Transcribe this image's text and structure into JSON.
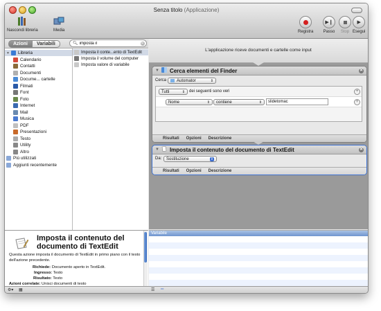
{
  "window": {
    "title": "Senza titolo",
    "title_suffix": "(Applicazione)"
  },
  "toolbar": {
    "hide_library": "Nascondi libreria",
    "media": "Media",
    "record": "Registra",
    "step": "Passo",
    "stop": "Stop",
    "run": "Esegui"
  },
  "tabs": {
    "actions": "Azioni",
    "variables": "Variabili"
  },
  "search": {
    "value": "imposta il"
  },
  "library": {
    "items": [
      {
        "label": "Libreria",
        "icon": "library-icon",
        "color": "#3a7bd5"
      },
      {
        "label": "Calendario",
        "icon": "calendar-icon",
        "color": "#d64a3a"
      },
      {
        "label": "Contatti",
        "icon": "contacts-icon",
        "color": "#8b6b3a"
      },
      {
        "label": "Documenti",
        "icon": "documents-icon",
        "color": "#b0b0b0"
      },
      {
        "label": "Docume... cartelle",
        "icon": "folders-icon",
        "color": "#4a8bd6"
      },
      {
        "label": "Filmati",
        "icon": "movies-icon",
        "color": "#2a5aa8"
      },
      {
        "label": "Font",
        "icon": "font-icon",
        "color": "#777777"
      },
      {
        "label": "Foto",
        "icon": "photos-icon",
        "color": "#6a8a4a"
      },
      {
        "label": "Internet",
        "icon": "internet-icon",
        "color": "#3a6ab0"
      },
      {
        "label": "Mail",
        "icon": "mail-icon",
        "color": "#6a8ab0"
      },
      {
        "label": "Musica",
        "icon": "music-icon",
        "color": "#4a7ad0"
      },
      {
        "label": "PDF",
        "icon": "pdf-icon",
        "color": "#c0c0c0"
      },
      {
        "label": "Presentazioni",
        "icon": "presentations-icon",
        "color": "#c86a2a"
      },
      {
        "label": "Testo",
        "icon": "text-icon",
        "color": "#aaaaaa"
      },
      {
        "label": "Utility",
        "icon": "utility-icon",
        "color": "#888888"
      },
      {
        "label": "Altro",
        "icon": "other-icon",
        "color": "#888888"
      },
      {
        "label": "Più utilizzati",
        "icon": "most-used-icon",
        "color": "#8aa8d8"
      },
      {
        "label": "Aggiunti recentemente",
        "icon": "recently-added-icon",
        "color": "#8aa8d8"
      }
    ]
  },
  "actions_list": {
    "items": [
      {
        "label": "Imposta il conte...ento di TextEdit",
        "icon": "textedit-icon"
      },
      {
        "label": "Imposta il volume del computer",
        "icon": "volume-icon"
      },
      {
        "label": "Imposta valore di variabile",
        "icon": "variable-icon"
      }
    ]
  },
  "description": {
    "title_line1": "Imposta il contenuto del",
    "title_line2": "documento di TextEdit",
    "text": "Questa azione imposta il documento di TextEdit in primo piano con il testo dell'azione precedente.",
    "requires_label": "Richiede:",
    "requires_value": "Documento aperto in TextEdit.",
    "input_label": "Ingresso:",
    "input_value": "Testo",
    "result_label": "Risultato:",
    "result_value": "Testo",
    "related_label": "Azioni correlate:",
    "related_value": "Unisci documenti di testo"
  },
  "workflow": {
    "header": "L'applicazione riceve documenti e cartelle come input",
    "finder_action": {
      "title": "Cerca elementi del Finder",
      "search_label": "Cerca",
      "search_location": "Automator",
      "condition_scope": "Tutti",
      "condition_text": "dei seguenti sono veri",
      "field": "Nome",
      "operator": "contiene",
      "value": "slidetomac",
      "tab_results": "Risultati",
      "tab_options": "Opzioni",
      "tab_description": "Descrizione"
    },
    "textedit_action": {
      "title": "Imposta il contenuto del documento di TextEdit",
      "mode_label": "Da:",
      "mode_value": "Sostituzione",
      "tab_results": "Risultati",
      "tab_options": "Opzioni",
      "tab_description": "Descrizione"
    }
  },
  "variables_panel": {
    "header": "Variabile"
  }
}
